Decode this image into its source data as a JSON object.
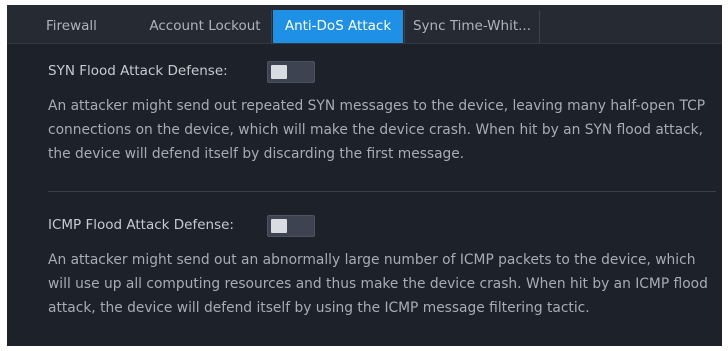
{
  "tabs": [
    {
      "label": "Firewall",
      "active": false
    },
    {
      "label": "Account Lockout",
      "active": false
    },
    {
      "label": "Anti-DoS Attack",
      "active": true
    },
    {
      "label": "Sync Time-Whit...",
      "active": false
    }
  ],
  "syn": {
    "label": "SYN Flood Attack Defense:",
    "enabled": false,
    "description": "An attacker might send out repeated SYN messages to the device, leaving many half-open TCP connections on the device, which will make the device crash. When hit by an SYN flood attack, the device will defend itself by discarding the first message."
  },
  "icmp": {
    "label": "ICMP Flood Attack Defense:",
    "enabled": false,
    "description": "An attacker might send out an abnormally large number of ICMP packets to the device, which will use up all computing resources and thus make the device crash. When hit by an ICMP flood attack, the device will defend itself by using the ICMP message filtering tactic."
  },
  "colors": {
    "accent": "#1e90e6",
    "background": "#1d212a",
    "tabbar": "#252a33"
  }
}
